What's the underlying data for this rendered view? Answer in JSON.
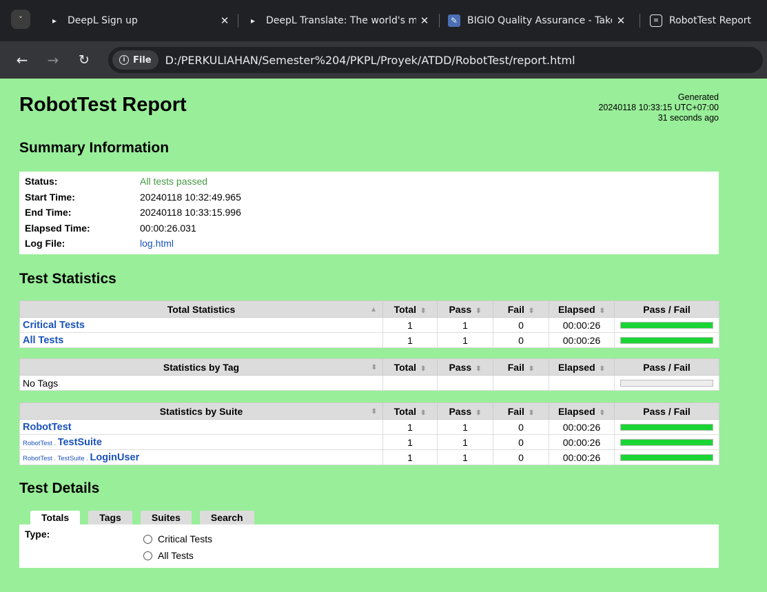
{
  "browser": {
    "tabs": [
      {
        "title": "DeepL Sign up",
        "icon": "deepl-icon"
      },
      {
        "title": "DeepL Translate: The world's mo",
        "icon": "deepl-icon"
      },
      {
        "title": "BIGIO Quality Assurance - Take",
        "icon": "notepad-icon"
      },
      {
        "title": "RobotTest Report",
        "icon": "robot-icon"
      }
    ],
    "site_chip": "File",
    "url": "D:/PERKULIAHAN/Semester%204/PKPL/Proyek/ATDD/RobotTest/report.html"
  },
  "report": {
    "title": "RobotTest Report",
    "generated_label": "Generated",
    "generated_time": "20240118 10:33:15 UTC+07:00",
    "generated_ago": "31 seconds ago"
  },
  "summary": {
    "heading": "Summary Information",
    "rows": [
      {
        "label": "Status:",
        "value": "All tests passed"
      },
      {
        "label": "Start Time:",
        "value": "20240118 10:32:49.965"
      },
      {
        "label": "End Time:",
        "value": "20240118 10:33:15.996"
      },
      {
        "label": "Elapsed Time:",
        "value": "00:00:26.031"
      },
      {
        "label": "Log File:",
        "value": "log.html"
      }
    ]
  },
  "statistics": {
    "heading": "Test Statistics",
    "columns": {
      "total": "Total",
      "pass": "Pass",
      "fail": "Fail",
      "elapsed": "Elapsed",
      "passfail": "Pass / Fail"
    },
    "total": {
      "header": "Total Statistics",
      "rows": [
        {
          "name": "Critical Tests",
          "total": "1",
          "pass": "1",
          "fail": "0",
          "elapsed": "00:00:26",
          "pass_fraction": 1
        },
        {
          "name": "All Tests",
          "total": "1",
          "pass": "1",
          "fail": "0",
          "elapsed": "00:00:26",
          "pass_fraction": 1
        }
      ]
    },
    "tag": {
      "header": "Statistics by Tag",
      "empty": "No Tags"
    },
    "suite": {
      "header": "Statistics by Suite",
      "rows": [
        {
          "parent": "",
          "name": "RobotTest",
          "total": "1",
          "pass": "1",
          "fail": "0",
          "elapsed": "00:00:26",
          "pass_fraction": 1
        },
        {
          "parent": "RobotTest . ",
          "name": "TestSuite",
          "total": "1",
          "pass": "1",
          "fail": "0",
          "elapsed": "00:00:26",
          "pass_fraction": 1
        },
        {
          "parent": "RobotTest . TestSuite . ",
          "name": "LoginUser",
          "total": "1",
          "pass": "1",
          "fail": "0",
          "elapsed": "00:00:26",
          "pass_fraction": 1
        }
      ]
    }
  },
  "details": {
    "heading": "Test Details",
    "tabs": [
      "Totals",
      "Tags",
      "Suites",
      "Search"
    ],
    "type_label": "Type:",
    "options": [
      "Critical Tests",
      "All Tests"
    ]
  },
  "colors": {
    "page_bg": "#99ee99",
    "pass_bar": "#1ad534",
    "link": "#1a52b9"
  }
}
